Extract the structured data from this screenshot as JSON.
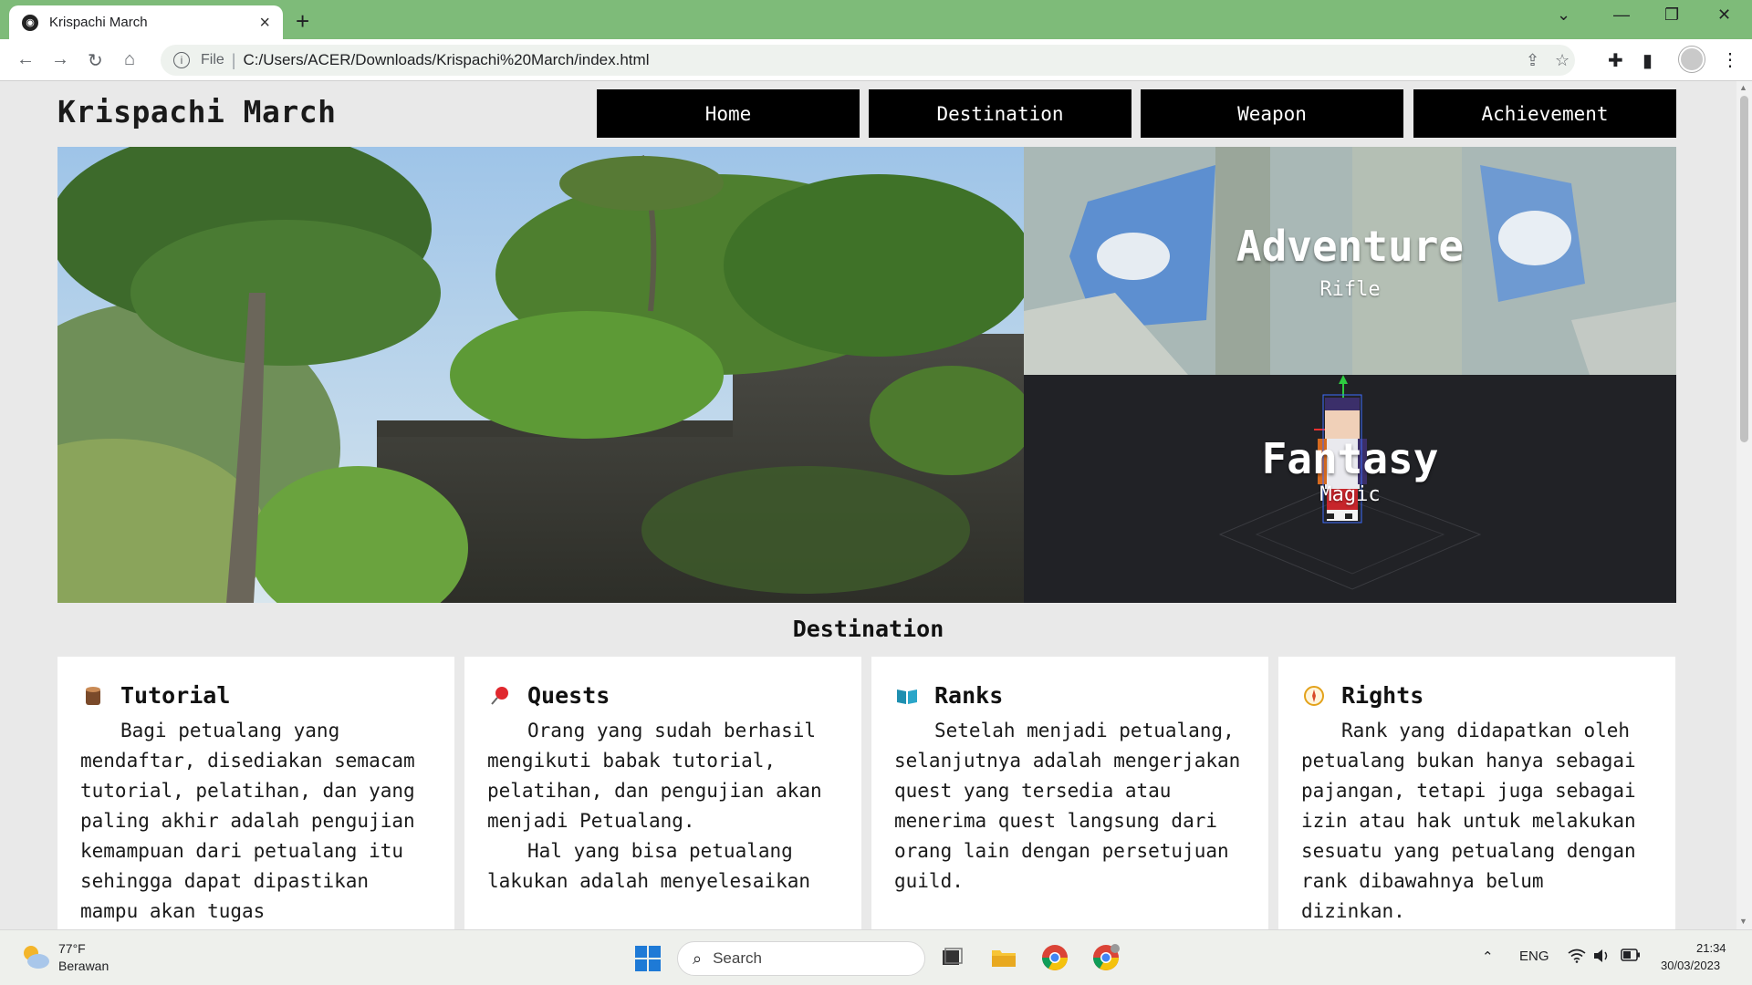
{
  "browser": {
    "tab_title": "Krispachi March",
    "omnibox_scheme": "File",
    "omnibox_url": "C:/Users/ACER/Downloads/Krispachi%20March/index.html"
  },
  "site": {
    "title": "Krispachi March",
    "nav": [
      "Home",
      "Destination",
      "Weapon",
      "Achievement"
    ]
  },
  "hero": {
    "top_right": {
      "title": "Adventure",
      "subtitle": "Rifle"
    },
    "bottom_right": {
      "title": "Fantasy",
      "subtitle": "Magic"
    }
  },
  "destination": {
    "heading": "Destination",
    "cards": [
      {
        "icon": "wood-log-icon",
        "title": "Tutorial",
        "paragraphs": [
          "Bagi petualang yang mendaftar, disediakan semacam tutorial, pelatihan, dan yang paling akhir adalah pengujian kemampuan dari petualang itu sehingga dapat dipastikan mampu akan tugas"
        ]
      },
      {
        "icon": "pushpin-icon",
        "title": "Quests",
        "paragraphs": [
          "Orang yang sudah berhasil mengikuti babak tutorial, pelatihan, dan pengujian akan menjadi Petualang.",
          "Hal yang bisa petualang lakukan adalah menyelesaikan"
        ]
      },
      {
        "icon": "open-book-icon",
        "title": "Ranks",
        "paragraphs": [
          "Setelah menjadi petualang, selanjutnya adalah mengerjakan quest yang tersedia atau menerima quest langsung dari orang lain dengan persetujuan guild."
        ]
      },
      {
        "icon": "compass-icon",
        "title": "Rights",
        "paragraphs": [
          "Rank yang didapatkan oleh petualang bukan hanya sebagai pajangan, tetapi juga sebagai izin atau hak untuk melakukan sesuatu yang petualang dengan rank dibawahnya belum dizinkan."
        ]
      }
    ]
  },
  "taskbar": {
    "weather_temp": "77°F",
    "weather_desc": "Berawan",
    "search_placeholder": "Search",
    "language": "ENG",
    "time": "21:34",
    "date": "30/03/2023"
  }
}
